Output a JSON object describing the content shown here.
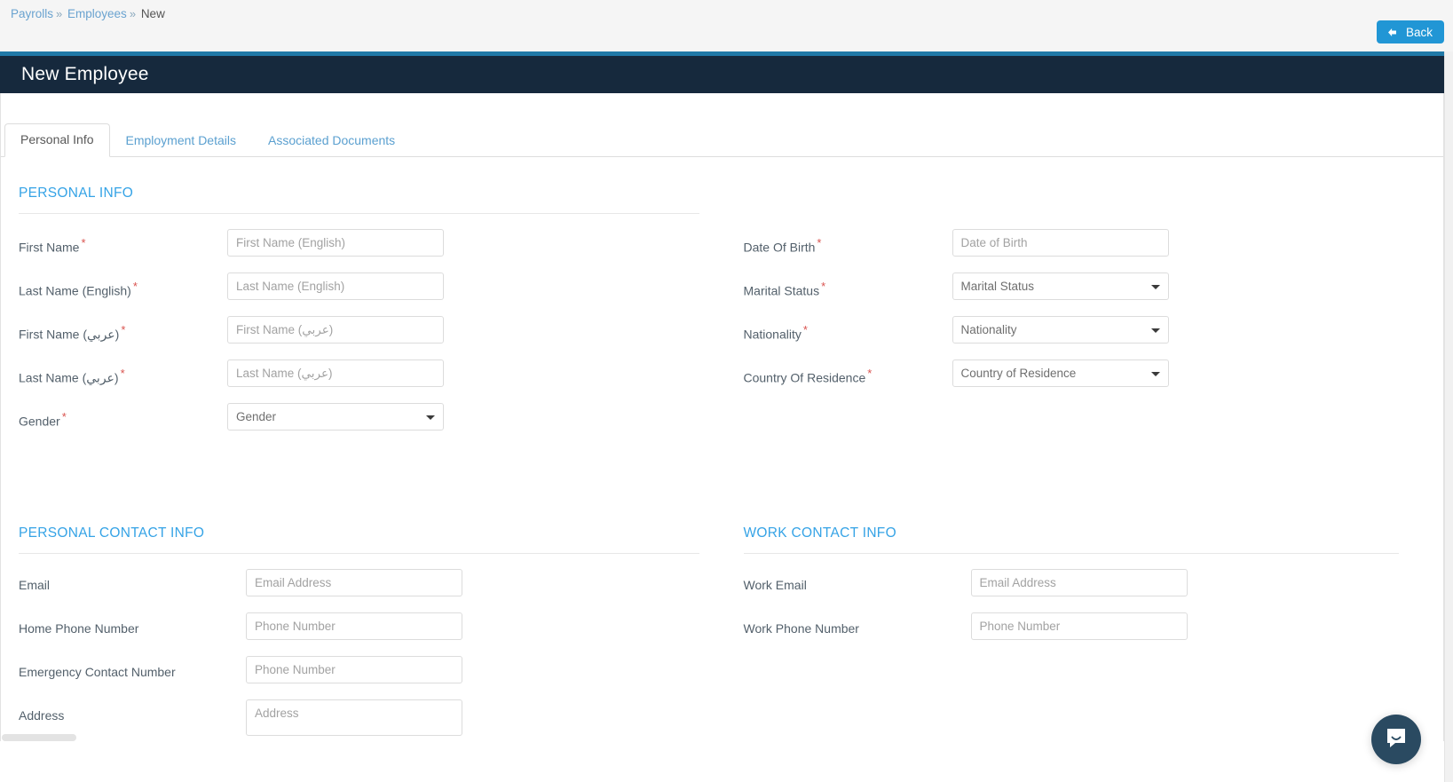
{
  "breadcrumb": {
    "items": [
      {
        "label": "Payrolls",
        "link": true
      },
      {
        "label": "Employees",
        "link": true
      },
      {
        "label": "New",
        "link": false
      }
    ],
    "separator": "»"
  },
  "toolbar": {
    "back_label": "Back",
    "back_icon": "arrow-left-icon",
    "accent_color": "#2196d5"
  },
  "header": {
    "title": "New Employee",
    "background_color": "#16293d",
    "accent_strip_color": "#2079a8"
  },
  "tabs": [
    {
      "label": "Personal Info",
      "active": true
    },
    {
      "label": "Employment Details",
      "active": false
    },
    {
      "label": "Associated Documents",
      "active": false
    }
  ],
  "sections": {
    "personal_info": {
      "title": "PERSONAL INFO",
      "color": "#35a3e6",
      "left_fields": [
        {
          "label": "First Name",
          "required": true,
          "type": "text",
          "placeholder": "First Name (English)",
          "value": ""
        },
        {
          "label": "Last Name (English)",
          "required": true,
          "type": "text",
          "placeholder": "Last Name (English)",
          "value": ""
        },
        {
          "label": "First Name (عربي)",
          "required": true,
          "type": "text",
          "placeholder": "First Name (عربي)",
          "value": ""
        },
        {
          "label": "Last Name (عربي)",
          "required": true,
          "type": "text",
          "placeholder": "Last Name (عربي)",
          "value": ""
        },
        {
          "label": "Gender",
          "required": true,
          "type": "select",
          "placeholder": "Gender",
          "value": "Gender"
        }
      ],
      "right_fields": [
        {
          "label": "Date Of Birth",
          "required": true,
          "type": "text",
          "placeholder": "Date of Birth",
          "value": ""
        },
        {
          "label": "Marital Status",
          "required": true,
          "type": "select",
          "placeholder": "Marital Status",
          "value": "Marital Status"
        },
        {
          "label": "Nationality",
          "required": true,
          "type": "select",
          "placeholder": "Nationality",
          "value": "Nationality"
        },
        {
          "label": "Country Of Residence",
          "required": true,
          "type": "select",
          "placeholder": "Country of Residence",
          "value": "Country of Residence"
        }
      ]
    },
    "personal_contact_info": {
      "title": "PERSONAL CONTACT INFO",
      "color": "#35a3e6",
      "fields": [
        {
          "label": "Email",
          "required": false,
          "type": "text",
          "placeholder": "Email Address",
          "value": ""
        },
        {
          "label": "Home Phone Number",
          "required": false,
          "type": "text",
          "placeholder": "Phone Number",
          "value": ""
        },
        {
          "label": "Emergency Contact Number",
          "required": false,
          "type": "text",
          "placeholder": "Phone Number",
          "value": ""
        },
        {
          "label": "Address",
          "required": false,
          "type": "textarea",
          "placeholder": "Address",
          "value": ""
        }
      ]
    },
    "work_contact_info": {
      "title": "WORK CONTACT INFO",
      "color": "#35a3e6",
      "fields": [
        {
          "label": "Work Email",
          "required": false,
          "type": "text",
          "placeholder": "Email Address",
          "value": ""
        },
        {
          "label": "Work Phone Number",
          "required": false,
          "type": "text",
          "placeholder": "Phone Number",
          "value": ""
        }
      ]
    }
  },
  "chat_widget": {
    "icon": "chat-bubble-smile-icon",
    "color": "#2a4a61"
  }
}
